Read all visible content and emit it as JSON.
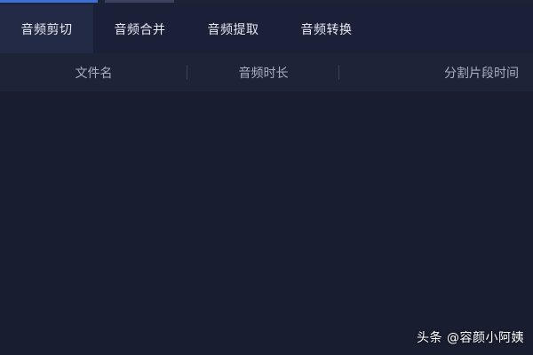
{
  "tabs": [
    {
      "label": "音频剪切",
      "active": true
    },
    {
      "label": "音频合并",
      "active": false
    },
    {
      "label": "音频提取",
      "active": false
    },
    {
      "label": "音频转换",
      "active": false
    }
  ],
  "table": {
    "columns": [
      "文件名",
      "音频时长",
      "分割片段时间"
    ],
    "rows": []
  },
  "watermark": "头条 @容颜小阿姨",
  "colors": {
    "background": "#181d2f",
    "tabbar": "#1a2038",
    "active_tab": "#222a45",
    "header": "#1e2438",
    "accent": "#3a6fd8"
  }
}
